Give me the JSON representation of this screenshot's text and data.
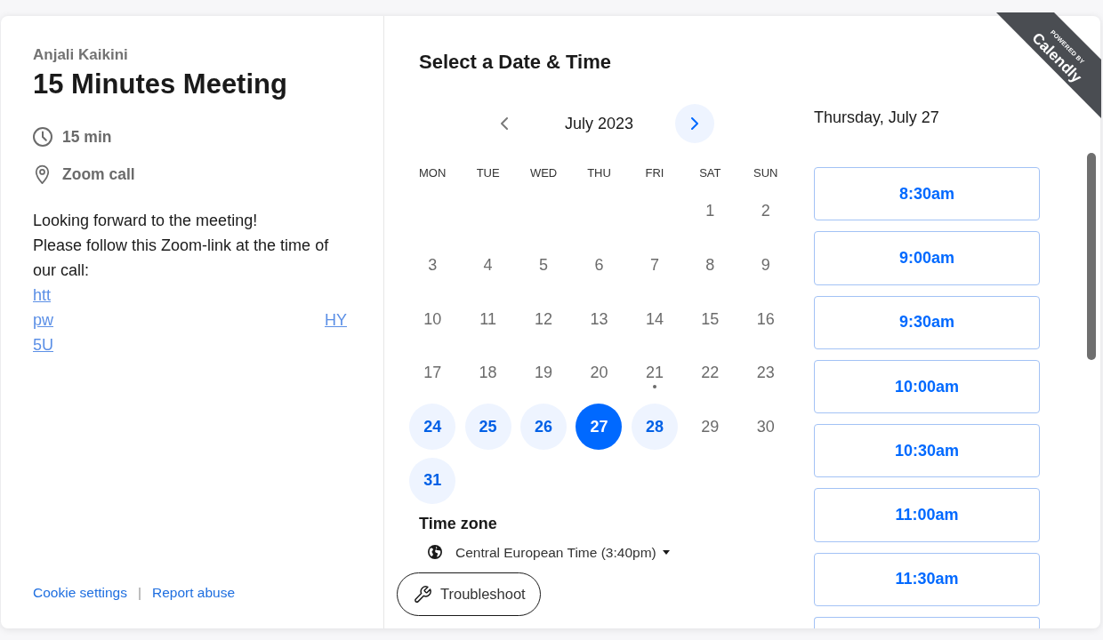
{
  "organizer": "Anjali Kaikini",
  "event_title": "15 Minutes Meeting",
  "details": [
    {
      "kind": "duration",
      "label": "15 min"
    },
    {
      "kind": "location",
      "label": "Zoom call"
    }
  ],
  "description": [
    "Looking forward to the meeting!",
    "Please follow this Zoom-link at the time of our call:"
  ],
  "link_lines": [
    {
      "parts": [
        "htt"
      ]
    },
    {
      "parts": [
        "pw",
        "HY"
      ]
    },
    {
      "parts": [
        "5U"
      ]
    }
  ],
  "footer_links": [
    {
      "label": "Cookie settings"
    },
    {
      "label": "Report abuse"
    }
  ],
  "footer_separator": "|",
  "heading": "Select a Date & Time",
  "calendar": {
    "month": "July 2023",
    "prev": {
      "disabled": true
    },
    "next": {
      "disabled": false
    },
    "weekdays": [
      "MON",
      "TUE",
      "WED",
      "THU",
      "FRI",
      "SAT",
      "SUN"
    ],
    "weeks": [
      {
        "days": [
          {
            "kind": "blank"
          },
          {
            "kind": "blank"
          },
          {
            "kind": "blank"
          },
          {
            "kind": "blank"
          },
          {
            "kind": "blank"
          },
          {
            "kind": "day",
            "label": "1",
            "available": false,
            "selected": false,
            "today": false
          },
          {
            "kind": "day",
            "label": "2",
            "available": false,
            "selected": false,
            "today": false
          }
        ]
      },
      {
        "days": [
          {
            "kind": "day",
            "label": "3",
            "available": false,
            "selected": false,
            "today": false
          },
          {
            "kind": "day",
            "label": "4",
            "available": false,
            "selected": false,
            "today": false
          },
          {
            "kind": "day",
            "label": "5",
            "available": false,
            "selected": false,
            "today": false
          },
          {
            "kind": "day",
            "label": "6",
            "available": false,
            "selected": false,
            "today": false
          },
          {
            "kind": "day",
            "label": "7",
            "available": false,
            "selected": false,
            "today": false
          },
          {
            "kind": "day",
            "label": "8",
            "available": false,
            "selected": false,
            "today": false
          },
          {
            "kind": "day",
            "label": "9",
            "available": false,
            "selected": false,
            "today": false
          }
        ]
      },
      {
        "days": [
          {
            "kind": "day",
            "label": "10",
            "available": false,
            "selected": false,
            "today": false
          },
          {
            "kind": "day",
            "label": "11",
            "available": false,
            "selected": false,
            "today": false
          },
          {
            "kind": "day",
            "label": "12",
            "available": false,
            "selected": false,
            "today": false
          },
          {
            "kind": "day",
            "label": "13",
            "available": false,
            "selected": false,
            "today": false
          },
          {
            "kind": "day",
            "label": "14",
            "available": false,
            "selected": false,
            "today": false
          },
          {
            "kind": "day",
            "label": "15",
            "available": false,
            "selected": false,
            "today": false
          },
          {
            "kind": "day",
            "label": "16",
            "available": false,
            "selected": false,
            "today": false
          }
        ]
      },
      {
        "days": [
          {
            "kind": "day",
            "label": "17",
            "available": false,
            "selected": false,
            "today": false
          },
          {
            "kind": "day",
            "label": "18",
            "available": false,
            "selected": false,
            "today": false
          },
          {
            "kind": "day",
            "label": "19",
            "available": false,
            "selected": false,
            "today": false
          },
          {
            "kind": "day",
            "label": "20",
            "available": false,
            "selected": false,
            "today": false
          },
          {
            "kind": "day",
            "label": "21",
            "available": false,
            "selected": false,
            "today": true
          },
          {
            "kind": "day",
            "label": "22",
            "available": false,
            "selected": false,
            "today": false
          },
          {
            "kind": "day",
            "label": "23",
            "available": false,
            "selected": false,
            "today": false
          }
        ]
      },
      {
        "days": [
          {
            "kind": "day",
            "label": "24",
            "available": true,
            "selected": false,
            "today": false
          },
          {
            "kind": "day",
            "label": "25",
            "available": true,
            "selected": false,
            "today": false
          },
          {
            "kind": "day",
            "label": "26",
            "available": true,
            "selected": false,
            "today": false
          },
          {
            "kind": "day",
            "label": "27",
            "available": true,
            "selected": true,
            "today": false
          },
          {
            "kind": "day",
            "label": "28",
            "available": true,
            "selected": false,
            "today": false
          },
          {
            "kind": "day",
            "label": "29",
            "available": false,
            "selected": false,
            "today": false
          },
          {
            "kind": "day",
            "label": "30",
            "available": false,
            "selected": false,
            "today": false
          }
        ]
      },
      {
        "days": [
          {
            "kind": "day",
            "label": "31",
            "available": true,
            "selected": false,
            "today": false
          }
        ]
      }
    ]
  },
  "time_zone": {
    "label": "Time zone",
    "value": "Central European Time (3:40pm)"
  },
  "troubleshoot": {
    "label": "Troubleshoot"
  },
  "times": {
    "date": "Thursday, July 27",
    "slots": [
      {
        "label": "8:30am",
        "selected": false
      },
      {
        "label": "9:00am",
        "selected": false
      },
      {
        "label": "9:30am",
        "selected": false
      },
      {
        "label": "10:00am",
        "selected": false
      },
      {
        "label": "10:30am",
        "selected": false
      },
      {
        "label": "11:00am",
        "selected": false
      },
      {
        "label": "11:30am",
        "selected": false
      }
    ],
    "more_below": true
  },
  "badge": {
    "caption": "POWERED BY",
    "brand": "Calendly"
  }
}
